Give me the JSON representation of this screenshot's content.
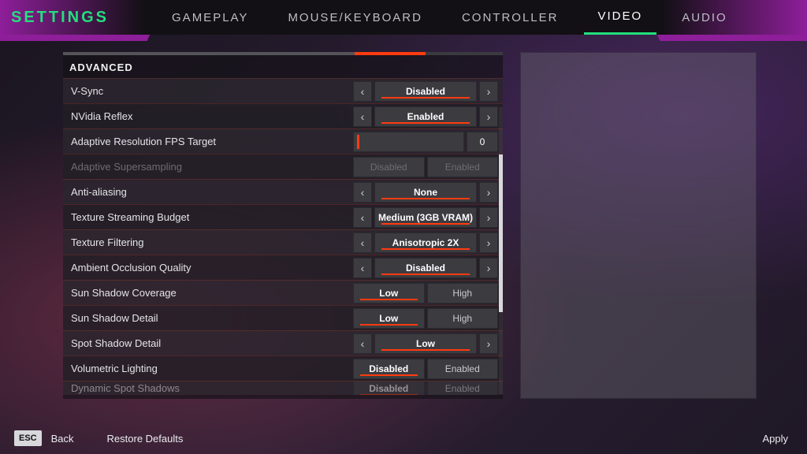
{
  "title": "SETTINGS",
  "tabs": [
    {
      "label": "GAMEPLAY",
      "active": false
    },
    {
      "label": "MOUSE/KEYBOARD",
      "active": false
    },
    {
      "label": "CONTROLLER",
      "active": false
    },
    {
      "label": "VIDEO",
      "active": true
    },
    {
      "label": "AUDIO",
      "active": false
    }
  ],
  "section_header": "ADVANCED",
  "rows": {
    "vsync": {
      "label": "V-Sync",
      "value": "Disabled"
    },
    "reflex": {
      "label": "NVidia Reflex",
      "value": "Enabled"
    },
    "adaptiveFps": {
      "label": "Adaptive Resolution FPS Target",
      "value": "0"
    },
    "adaptiveSS": {
      "label": "Adaptive Supersampling",
      "left": "Disabled",
      "right": "Enabled"
    },
    "aa": {
      "label": "Anti-aliasing",
      "value": "None"
    },
    "texBudget": {
      "label": "Texture Streaming Budget",
      "value": "Medium (3GB VRAM)"
    },
    "texFilter": {
      "label": "Texture Filtering",
      "value": "Anisotropic 2X"
    },
    "ao": {
      "label": "Ambient Occlusion Quality",
      "value": "Disabled"
    },
    "sunCoverage": {
      "label": "Sun Shadow Coverage",
      "left": "Low",
      "right": "High",
      "selected": "left"
    },
    "sunDetail": {
      "label": "Sun Shadow Detail",
      "left": "Low",
      "right": "High",
      "selected": "left"
    },
    "spotShadow": {
      "label": "Spot Shadow Detail",
      "value": "Low"
    },
    "volLight": {
      "label": "Volumetric Lighting",
      "left": "Disabled",
      "right": "Enabled",
      "selected": "left"
    },
    "dynSpot": {
      "label": "Dynamic Spot Shadows",
      "left": "Disabled",
      "right": "Enabled",
      "selected": "left"
    }
  },
  "footer": {
    "esc_key": "ESC",
    "back": "Back",
    "restore": "Restore Defaults",
    "apply": "Apply"
  }
}
